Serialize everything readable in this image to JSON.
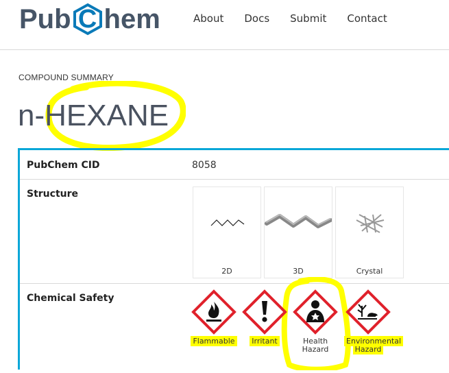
{
  "header": {
    "logo_left": "Pub",
    "logo_mid": "C",
    "logo_right": "hem",
    "nav": [
      "About",
      "Docs",
      "Submit",
      "Contact"
    ]
  },
  "page": {
    "kicker": "COMPOUND SUMMARY",
    "title": "n-HEXANE"
  },
  "summary": {
    "cid_label": "PubChem CID",
    "cid_value": "8058",
    "structure_label": "Structure",
    "structure_tiles": [
      "2D",
      "3D",
      "Crystal"
    ],
    "safety_label": "Chemical Safety",
    "hazards": [
      {
        "icon": "flame-icon",
        "lines": [
          "Flammable"
        ]
      },
      {
        "icon": "exclamation-icon",
        "lines": [
          "Irritant"
        ]
      },
      {
        "icon": "health-hazard-icon",
        "lines": [
          "Health",
          "Hazard"
        ]
      },
      {
        "icon": "environment-icon",
        "lines": [
          "Environmental",
          "Hazard"
        ]
      }
    ]
  },
  "colors": {
    "accent": "#0aa7d8",
    "logo": "#465567",
    "logo_hex": "#0a7ab8",
    "ghs_red": "#e0212b",
    "annotation": "#ffff00"
  }
}
